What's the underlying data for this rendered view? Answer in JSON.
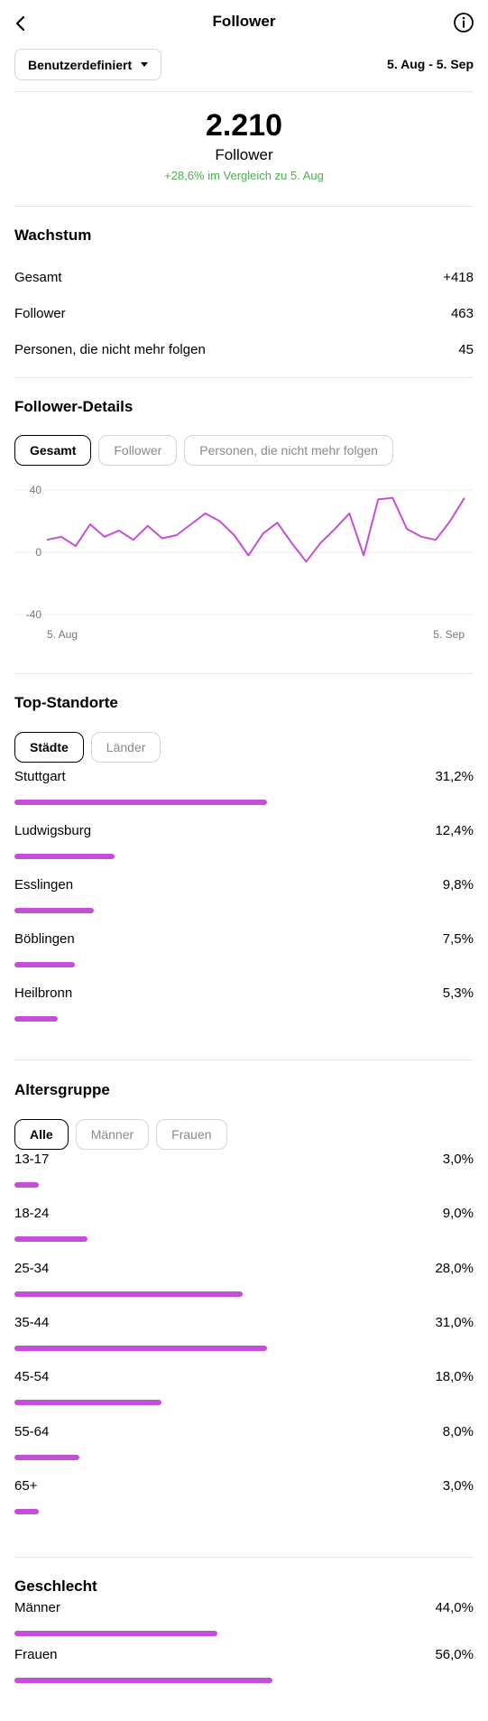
{
  "header": {
    "title": "Follower"
  },
  "filter": {
    "range_label": "Benutzerdefiniert",
    "date_range": "5. Aug - 5. Sep"
  },
  "summary": {
    "total": "2.210",
    "label": "Follower",
    "change": "+28,6% im Vergleich zu 5. Aug"
  },
  "growth": {
    "title": "Wachstum",
    "rows": [
      {
        "label": "Gesamt",
        "value": "+418"
      },
      {
        "label": "Follower",
        "value": "463"
      },
      {
        "label": "Personen, die nicht mehr folgen",
        "value": "45"
      }
    ]
  },
  "details": {
    "title": "Follower-Details",
    "tabs": [
      "Gesamt",
      "Follower",
      "Personen, die nicht mehr folgen"
    ],
    "active_tab": 0
  },
  "chart_data": {
    "type": "line",
    "x_start_label": "5. Aug",
    "x_end_label": "5. Sep",
    "yticks": [
      "40",
      "0",
      "-40"
    ],
    "ylim": [
      -40,
      40
    ],
    "color": "#c34fd6",
    "grid": true,
    "values": [
      8,
      10,
      4,
      18,
      10,
      14,
      8,
      17,
      9,
      11,
      18,
      25,
      20,
      11,
      -2,
      12,
      19,
      6,
      -6,
      6,
      15,
      25,
      -2,
      34,
      35,
      15,
      10,
      8,
      20,
      35
    ]
  },
  "locations": {
    "title": "Top-Standorte",
    "tabs": [
      "Städte",
      "Länder"
    ],
    "active_tab": 0,
    "items": [
      {
        "label": "Stuttgart",
        "pct": "31,2%",
        "value": 31.2
      },
      {
        "label": "Ludwigsburg",
        "pct": "12,4%",
        "value": 12.4
      },
      {
        "label": "Esslingen",
        "pct": "9,8%",
        "value": 9.8
      },
      {
        "label": "Böblingen",
        "pct": "7,5%",
        "value": 7.5
      },
      {
        "label": "Heilbronn",
        "pct": "5,3%",
        "value": 5.3
      }
    ]
  },
  "age": {
    "title": "Altersgruppe",
    "tabs": [
      "Alle",
      "Männer",
      "Frauen"
    ],
    "active_tab": 0,
    "items": [
      {
        "label": "13-17",
        "pct": "3,0%",
        "value": 3.0
      },
      {
        "label": "18-24",
        "pct": "9,0%",
        "value": 9.0
      },
      {
        "label": "25-34",
        "pct": "28,0%",
        "value": 28.0
      },
      {
        "label": "35-44",
        "pct": "31,0%",
        "value": 31.0
      },
      {
        "label": "45-54",
        "pct": "18,0%",
        "value": 18.0
      },
      {
        "label": "55-64",
        "pct": "8,0%",
        "value": 8.0
      },
      {
        "label": "65+",
        "pct": "3,0%",
        "value": 3.0
      }
    ]
  },
  "gender": {
    "title": "Geschlecht",
    "items": [
      {
        "label": "Männer",
        "pct": "44,0%",
        "value": 44.0
      },
      {
        "label": "Frauen",
        "pct": "56,0%",
        "value": 56.0
      }
    ]
  }
}
